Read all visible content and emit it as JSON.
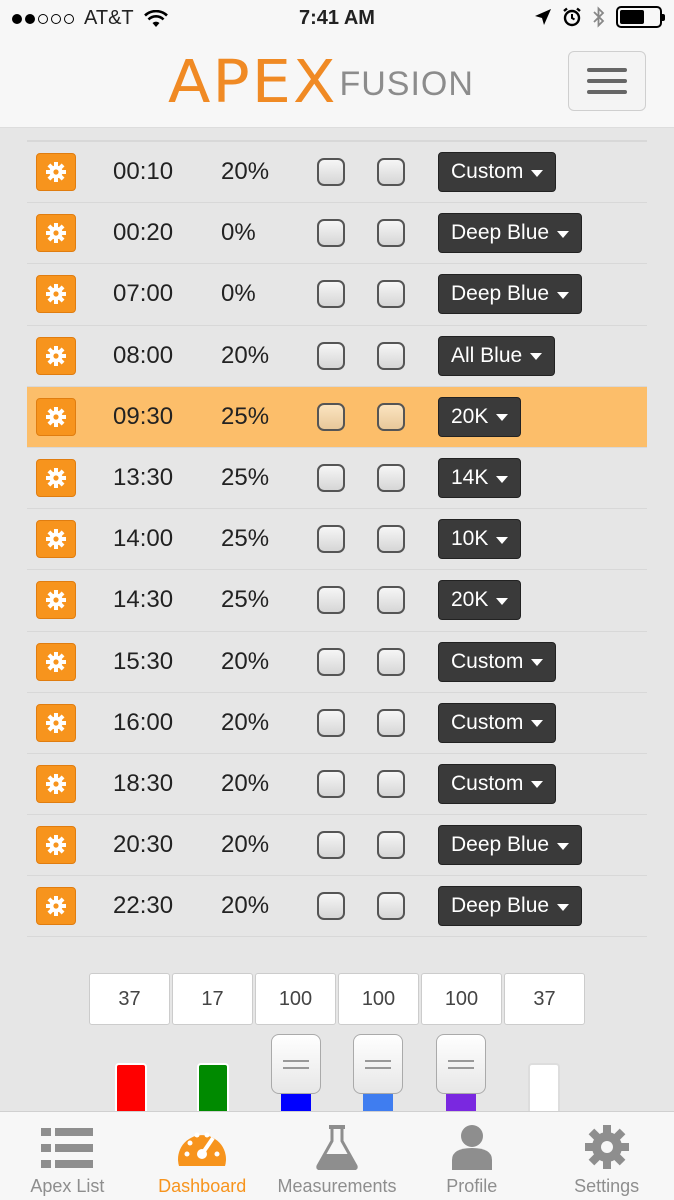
{
  "status_bar": {
    "carrier": "AT&T",
    "time": "7:41 AM",
    "battery_level": 0.62
  },
  "header": {
    "logo_main": "APEX",
    "logo_sub": "FUSION"
  },
  "schedule": {
    "rows": [
      {
        "time": "00:10",
        "intensity": "20%",
        "profile": "Custom"
      },
      {
        "time": "00:20",
        "intensity": "0%",
        "profile": "Deep Blue"
      },
      {
        "time": "07:00",
        "intensity": "0%",
        "profile": "Deep Blue"
      },
      {
        "time": "08:00",
        "intensity": "20%",
        "profile": "All Blue"
      },
      {
        "time": "09:30",
        "intensity": "25%",
        "profile": "20K",
        "highlighted": true
      },
      {
        "time": "13:30",
        "intensity": "25%",
        "profile": "14K"
      },
      {
        "time": "14:00",
        "intensity": "25%",
        "profile": "10K"
      },
      {
        "time": "14:30",
        "intensity": "25%",
        "profile": "20K"
      },
      {
        "time": "15:30",
        "intensity": "20%",
        "profile": "Custom"
      },
      {
        "time": "16:00",
        "intensity": "20%",
        "profile": "Custom"
      },
      {
        "time": "18:30",
        "intensity": "20%",
        "profile": "Custom"
      },
      {
        "time": "20:30",
        "intensity": "20%",
        "profile": "Deep Blue"
      },
      {
        "time": "22:30",
        "intensity": "20%",
        "profile": "Deep Blue"
      }
    ]
  },
  "channels": [
    {
      "value": "37",
      "color": "#ff0000"
    },
    {
      "value": "17",
      "color": "#008a00"
    },
    {
      "value": "100",
      "color": "#0000ff"
    },
    {
      "value": "100",
      "color": "#3f7df0"
    },
    {
      "value": "100",
      "color": "#7a28e0"
    },
    {
      "value": "37",
      "color": "#ffffff"
    }
  ],
  "tabbar": {
    "items": [
      {
        "label": "Apex List",
        "icon": "list-icon"
      },
      {
        "label": "Dashboard",
        "icon": "dashboard-gauge-icon",
        "active": true
      },
      {
        "label": "Measurements",
        "icon": "flask-icon"
      },
      {
        "label": "Profile",
        "icon": "person-icon"
      },
      {
        "label": "Settings",
        "icon": "gear-icon"
      }
    ]
  },
  "colors": {
    "accent": "#f7941d",
    "highlight_row": "#fcbe6a",
    "dropdown_bg": "#3a3a3a"
  }
}
